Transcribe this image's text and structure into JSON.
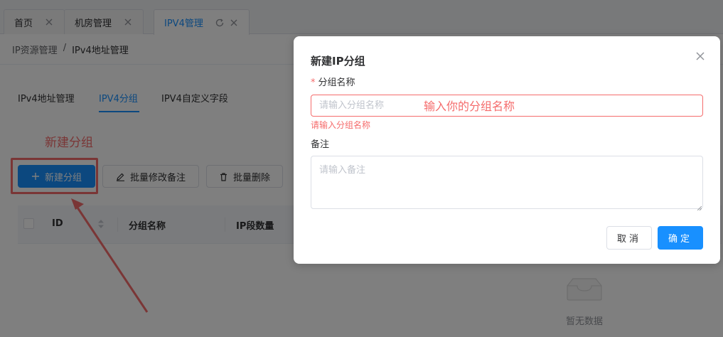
{
  "tabs": [
    {
      "label": "首页",
      "active": false
    },
    {
      "label": "机房管理",
      "active": false
    },
    {
      "label": "IPV4管理",
      "active": true
    }
  ],
  "breadcrumb": {
    "parent": "IP资源管理",
    "separator": "/",
    "current": "IPv4地址管理"
  },
  "subtabs": [
    "IPv4地址管理",
    "IPV4分组",
    "IPV4自定义字段"
  ],
  "annotations": {
    "new_group": "新建分组",
    "input_hint": "输入你的分组名称"
  },
  "toolbar": {
    "new_group": "新建分组",
    "batch_edit_remark": "批量修改备注",
    "batch_delete": "批量删除"
  },
  "table": {
    "columns": [
      "ID",
      "分组名称",
      "IP段数量"
    ],
    "empty_text": "暂无数据"
  },
  "dialog": {
    "title": "新建IP分组",
    "group_name_label": "分组名称",
    "group_name_placeholder": "请输入分组名称",
    "group_name_value": "",
    "group_name_error": "请输入分组名称",
    "remark_label": "备注",
    "remark_placeholder": "请输入备注",
    "remark_value": "",
    "cancel": "取消",
    "confirm": "确定"
  },
  "colors": {
    "primary": "#1890ff",
    "error": "#f56c6c",
    "annotation": "#f56c6c"
  },
  "icons": {
    "tab_close": "close-icon",
    "tab_refresh": "refresh-icon",
    "new": "plus-icon",
    "edit": "edit-icon",
    "delete": "trash-icon",
    "dialog_close": "close-icon",
    "empty": "empty-box-icon"
  }
}
